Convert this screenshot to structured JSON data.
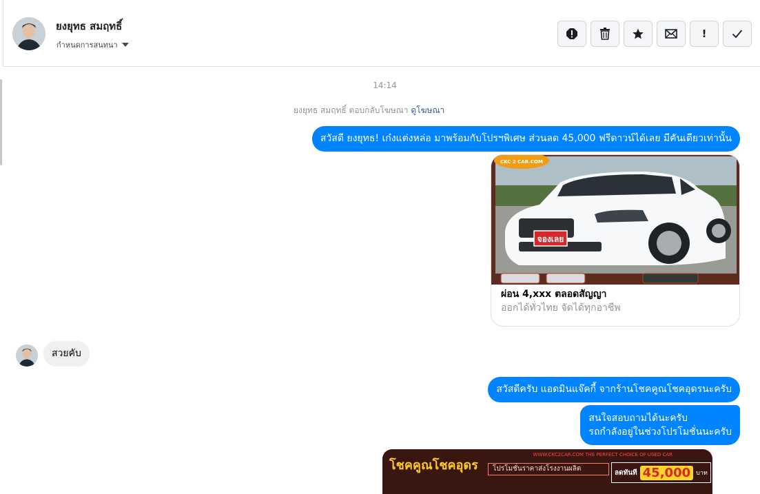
{
  "header": {
    "name": "ยงยุทธ สมฤทธิ์",
    "subtitle": "กำหนดการสนทนา",
    "toolbar": [
      {
        "name": "alert-icon",
        "label": "Mark as spam"
      },
      {
        "name": "trash-icon",
        "label": "Delete"
      },
      {
        "name": "star-icon",
        "label": "Star"
      },
      {
        "name": "envelope-icon",
        "label": "Mark as unread"
      },
      {
        "name": "exclamation-icon",
        "label": "Important"
      },
      {
        "name": "check-icon",
        "label": "Mark as done"
      }
    ]
  },
  "thread": {
    "timestamp": "14:14",
    "reply_note": {
      "text": "ยงยุทธ สมฤทธิ์ ตอบกลับโฆษณา",
      "link": "ดูโฆษณา"
    },
    "messages": {
      "out_1": "สวัสดี ยงยุทธ! เก๋งแต่งหล่อ มาพร้อมกับโปรฯพิเศษ ส่วนลด 45,000 ฟรีดาวน์ได้เลย มีคันเดียวเท่านั้น",
      "in_1": "สวยคับ",
      "out_2": "สวัสดีครับ แอดมินแจ๊คกี้ จากร้านโชคคูณโชคอุดรนะครับ",
      "out_3_line1": "สนใจสอบถามได้นะครับ",
      "out_3_line2": "รถกำลังอยู่ในช่วงโปรโมชั่นนะครับ"
    },
    "ad_card": {
      "image_logo": "CKC 2 CAR.COM",
      "image_badge": "จองเลย",
      "title": "ผ่อน 4,xxx ตลอดสัญญา",
      "subtitle": "ออกได้ทั่วไทย จัดได้ทุกอาชีพ"
    },
    "promo_image": {
      "brand": "โชคคูณโชคอุดร",
      "tagline": "WWW.CKC2CAR.COM THE PERFECT CHOICE OF USED CAR",
      "box": "โปรโมชั่นราคาส่งโรงงานผลิต",
      "discount_label": "ลดทันที",
      "discount_amount": "45,000",
      "discount_unit": "บาท"
    }
  },
  "colors": {
    "outgoing_bubble": "#0084ff",
    "incoming_bubble": "#f1f0f0",
    "link": "#385898",
    "muted_text": "#8d949e"
  }
}
